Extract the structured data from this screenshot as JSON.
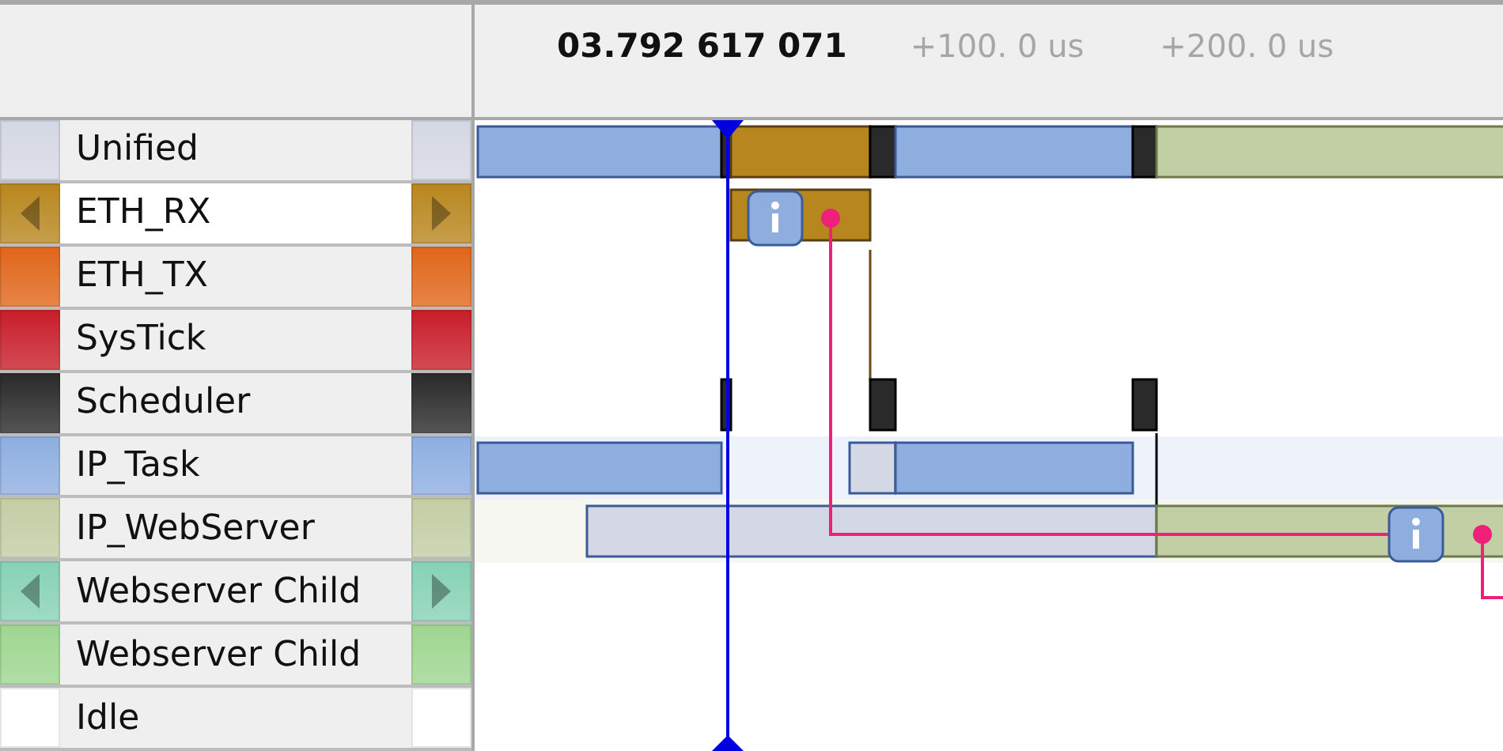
{
  "header": {
    "cursor_time": "03.792 617 071",
    "ticks": [
      "+100. 0 us",
      "+200. 0 us"
    ]
  },
  "rows": [
    {
      "name": "Unified",
      "color": "#d4d8e4",
      "selected": false,
      "arrows": false
    },
    {
      "name": "ETH_RX",
      "color": "#b8861e",
      "selected": true,
      "arrows": true
    },
    {
      "name": "ETH_TX",
      "color": "#e0661a",
      "selected": false,
      "arrows": false
    },
    {
      "name": "SysTick",
      "color": "#c81e2a",
      "selected": false,
      "arrows": false
    },
    {
      "name": "Scheduler",
      "color": "#2a2a2a",
      "selected": false,
      "arrows": false
    },
    {
      "name": "IP_Task",
      "color": "#8eaee0",
      "selected": false,
      "arrows": false
    },
    {
      "name": "IP_WebServer",
      "color": "#c2cea4",
      "selected": false,
      "arrows": false
    },
    {
      "name": "Webserver Child",
      "color": "#86d2b4",
      "selected": false,
      "arrows": true
    },
    {
      "name": "Webserver Child",
      "color": "#9ed690",
      "selected": false,
      "arrows": false
    },
    {
      "name": "Idle",
      "color": "#ffffff",
      "selected": false,
      "arrows": false
    }
  ]
}
